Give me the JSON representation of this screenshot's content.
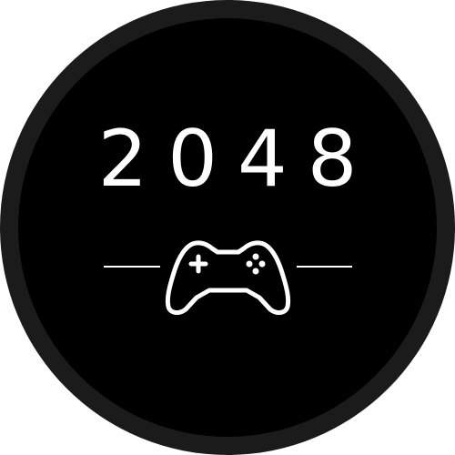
{
  "logo": {
    "title": "2048",
    "icon": "gamepad-icon",
    "colors": {
      "background": "#000000",
      "ring": "#1b1b1b",
      "foreground": "#ffffff"
    }
  }
}
